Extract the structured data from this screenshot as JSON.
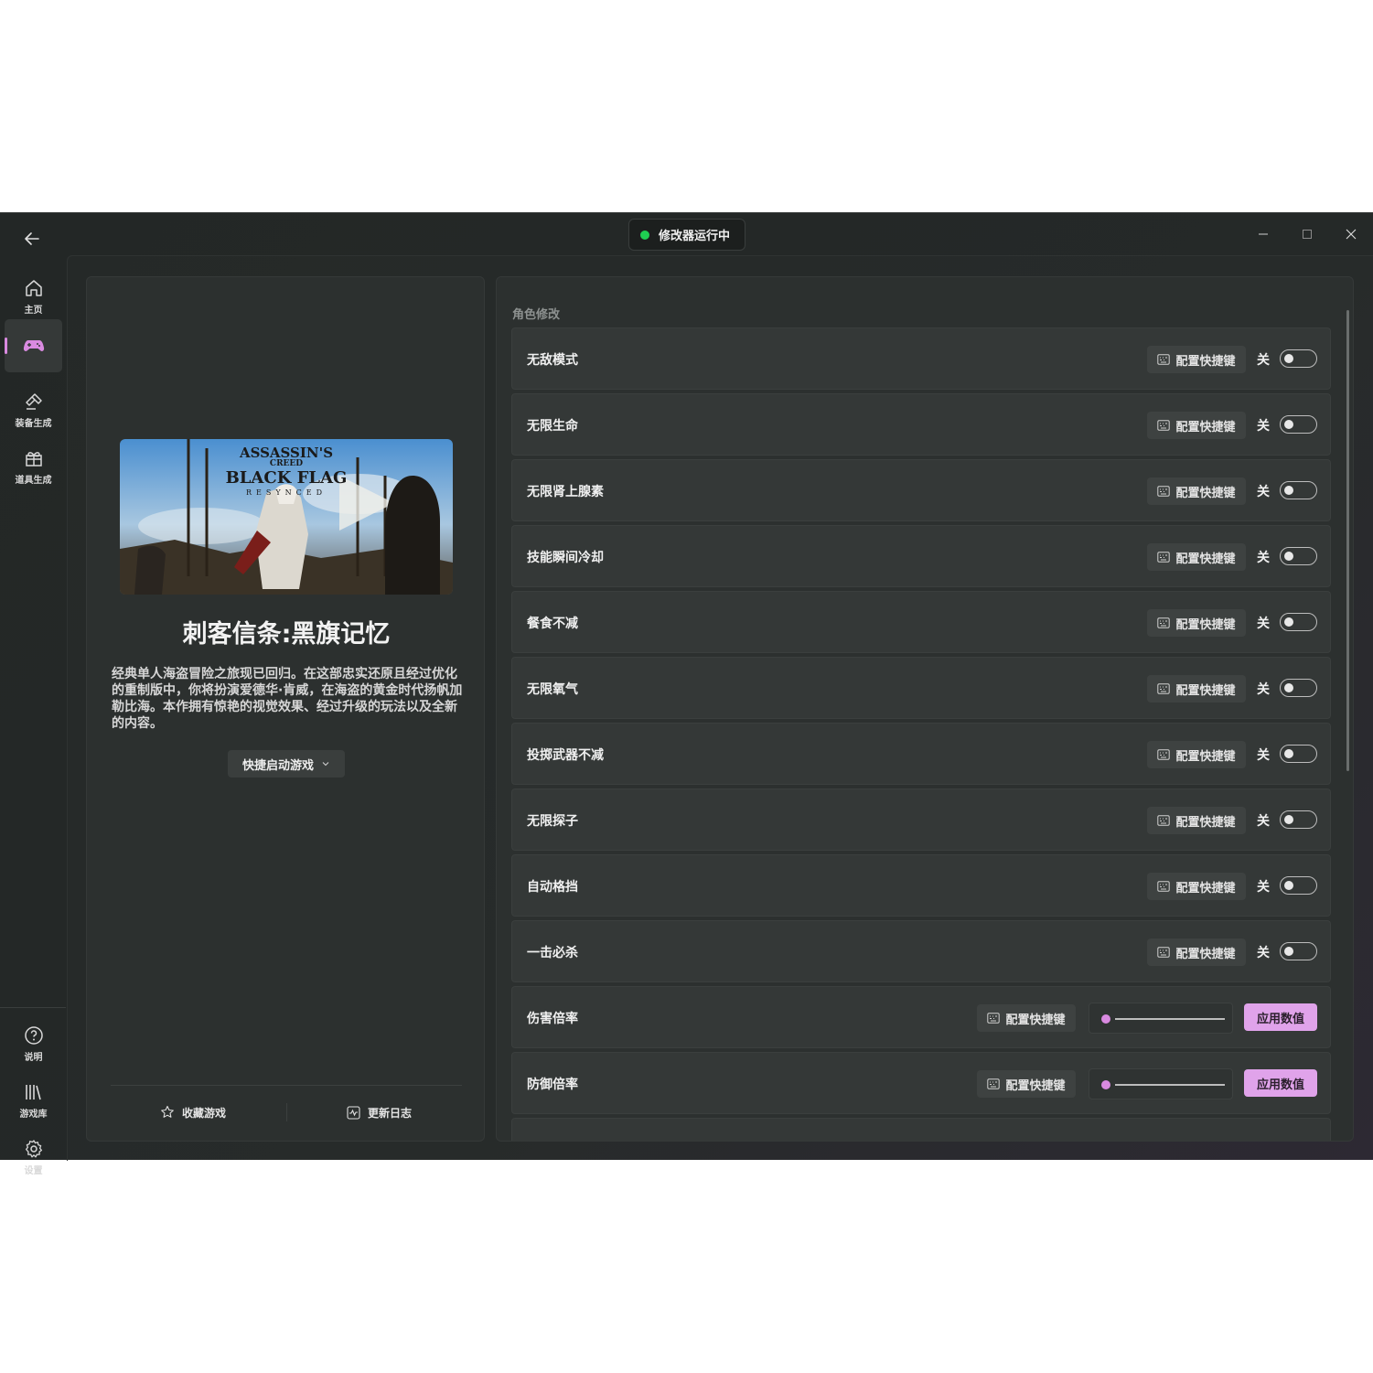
{
  "titlebar": {
    "status_text": "修改器运行中",
    "status_color": "#1fcf52"
  },
  "sidebar": {
    "top_items": [
      {
        "label": "主页",
        "icon": "home-icon"
      },
      {
        "label": "",
        "icon": "gamepad-icon",
        "active": true
      },
      {
        "label": "装备生成",
        "icon": "hammer-icon"
      },
      {
        "label": "道具生成",
        "icon": "gift-icon"
      }
    ],
    "bottom_items": [
      {
        "label": "说明",
        "icon": "help-icon"
      },
      {
        "label": "游戏库",
        "icon": "library-icon"
      },
      {
        "label": "设置",
        "icon": "gear-icon"
      }
    ]
  },
  "game": {
    "cover_text": {
      "line1": "ASSASSIN'S",
      "line2": "CREED",
      "line3": "BLACK FLAG",
      "line4": "RESYNCED"
    },
    "title": "刺客信条:黑旗记忆",
    "description": "经典单人海盗冒险之旅现已回归。在这部忠实还原且经过优化的重制版中，你将扮演爱德华·肯威，在海盗的黄金时代扬帆加勒比海。本作拥有惊艳的视觉效果、经过升级的玩法以及全新的内容。",
    "launch_label": "快捷启动游戏",
    "favorite_label": "收藏游戏",
    "changelog_label": "更新日志"
  },
  "cheats": {
    "section_title": "角色修改",
    "hotkey_label": "配置快捷键",
    "off_label": "关",
    "apply_label": "应用数值",
    "accent_color": "#d98ae0",
    "toggles": [
      {
        "name": "无敌模式",
        "state": "关"
      },
      {
        "name": "无限生命",
        "state": "关"
      },
      {
        "name": "无限肾上腺素",
        "state": "关"
      },
      {
        "name": "技能瞬间冷却",
        "state": "关"
      },
      {
        "name": "餐食不减",
        "state": "关"
      },
      {
        "name": "无限氧气",
        "state": "关"
      },
      {
        "name": "投掷武器不减",
        "state": "关"
      },
      {
        "name": "无限探子",
        "state": "关"
      },
      {
        "name": "自动格挡",
        "state": "关"
      },
      {
        "name": "一击必杀",
        "state": "关"
      }
    ],
    "sliders": [
      {
        "name": "伤害倍率",
        "value_fraction": 0
      },
      {
        "name": "防御倍率",
        "value_fraction": 0
      }
    ]
  }
}
